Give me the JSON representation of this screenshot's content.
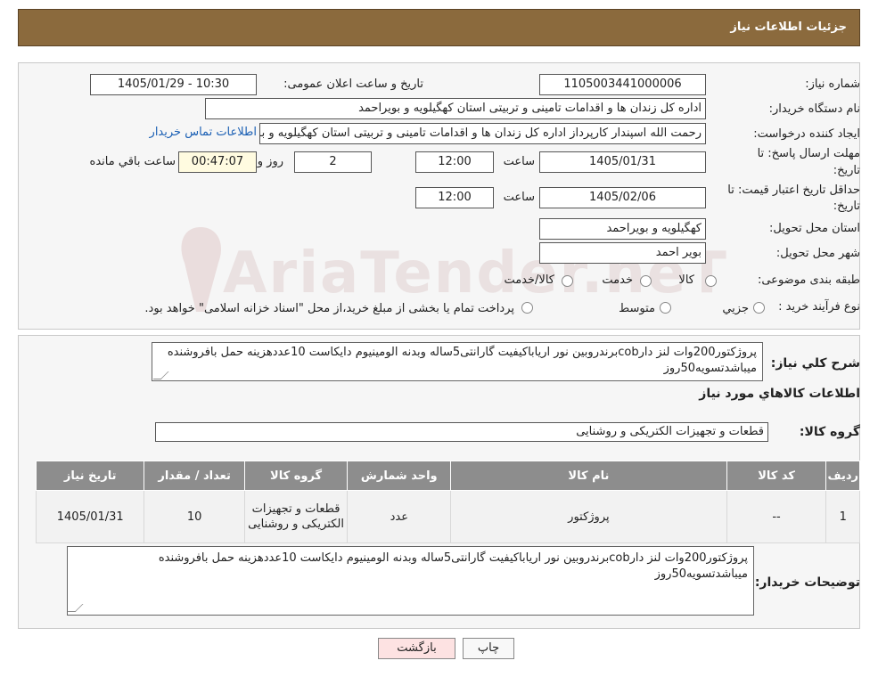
{
  "header": {
    "title": "جزئیات اطلاعات نیاز"
  },
  "form": {
    "need_number_label": "شماره نیاز:",
    "need_number": "1105003441000006",
    "announce_label": "تاریخ و ساعت اعلان عمومی:",
    "announce_value": "1405/01/29 - 10:30",
    "buyer_org_label": "نام دستگاه خریدار:",
    "buyer_org": "اداره کل زندان ها و اقدامات تامینی و تربیتی استان کهگیلویه و بویراحمد",
    "creator_label": "ایجاد کننده درخواست:",
    "creator": "رحمت الله اسپندار کارپرداز اداره کل زندان ها و اقدامات تامینی و تربیتی استان کهگیلویه و بویراحمد",
    "contact_link": "اطلاعات تماس خریدار",
    "deadline_label_1": "مهلت ارسال پاسخ: تا",
    "deadline_label_2": "تاریخ:",
    "deadline_date": "1405/01/31",
    "time_word": "ساعت",
    "deadline_time": "12:00",
    "days_count": "2",
    "days_word": "روز و",
    "remaining_time": "00:47:07",
    "remaining_word": "ساعت باقي مانده",
    "validity_label_1": "حداقل تاریخ اعتبار قیمت: تا",
    "validity_label_2": "تاریخ:",
    "validity_date": "1405/02/06",
    "validity_time": "12:00",
    "province_label": "استان محل تحویل:",
    "province": "کهگیلویه و بویراحمد",
    "city_label": "شهر محل تحویل:",
    "city": "بویر احمد",
    "category_label": "طبقه بندی موضوعی:",
    "category_options": [
      "کالا",
      "خدمت",
      "کالا/خدمت"
    ],
    "process_label": "نوع فرآیند خرید :",
    "process_options": [
      "جزيي",
      "متوسط"
    ],
    "process_note": "پرداخت تمام یا بخشی از مبلغ خرید،از محل \"اسناد خزانه اسلامی\" خواهد بود."
  },
  "details": {
    "summary_label": "شرح کلي نياز:",
    "summary": "پروژکتور200وات لنز دارcobبرندروبین نور اریاباکیفیت گارانتی5ساله وبدنه الومینیوم دایکاست 10عددهزینه حمل بافروشنده میباشدتسویه50روز",
    "goods_info_title": "اطلاعات کالاهاي مورد نياز",
    "goods_group_label": "گروه کالا:",
    "goods_group": "قطعات و تجهیزات الکتریکی و روشنایی"
  },
  "table": {
    "headers": [
      "رديف",
      "کد کالا",
      "نام کالا",
      "واحد شمارش",
      "گروه کالا",
      "تعداد / مقدار",
      "تاريخ نياز"
    ],
    "rows": [
      [
        "1",
        "--",
        "پروژکتور",
        "عدد",
        "قطعات و تجهیزات الکتریکی و روشنایی",
        "10",
        "1405/01/31"
      ]
    ]
  },
  "buyer_notes": {
    "label": "توضیحات خریدار:",
    "text": "پروژکتور200وات لنز دارcobبرندروبین نور اریاباکیفیت گارانتی5ساله وبدنه الومینیوم دایکاست 10عددهزینه حمل بافروشنده میباشدتسویه50روز"
  },
  "buttons": {
    "print": "چاپ",
    "back": "بازگشت"
  },
  "watermark": "AriaTender.neT",
  "colors": {
    "header_bg": "#8b6a3d",
    "table_header_bg": "#8d8d8d",
    "back_button_bg": "#fde2e2"
  }
}
